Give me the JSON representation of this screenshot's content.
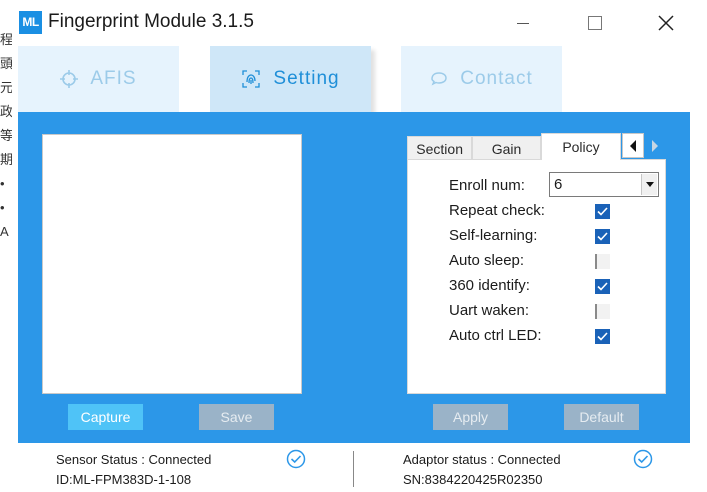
{
  "window": {
    "title": "Fingerprint Module 3.1.5",
    "logo_text": "ML",
    "accent_color": "#2c97e8"
  },
  "tabs": [
    {
      "label": "AFIS",
      "icon": "crosshair-icon",
      "active": false
    },
    {
      "label": "Setting",
      "icon": "fingerprint-icon",
      "active": true
    },
    {
      "label": "Contact",
      "icon": "chat-bubble-icon",
      "active": false
    }
  ],
  "background_text": [
    "程",
    "頭",
    "元",
    "政",
    "等",
    "期",
    "•",
    "•",
    "A"
  ],
  "buttons": {
    "capture": "Capture",
    "save": "Save",
    "apply": "Apply",
    "default": "Default"
  },
  "property_sheet": {
    "tabs": [
      "Section",
      "Gain",
      "Policy"
    ],
    "active_tab": "Policy",
    "enroll_num": {
      "label": "Enroll num:",
      "value": "6"
    },
    "options": [
      {
        "label": "Repeat check:",
        "checked": true
      },
      {
        "label": "Self-learning:",
        "checked": true
      },
      {
        "label": "Auto sleep:",
        "checked": false
      },
      {
        "label": "360 identify:",
        "checked": true
      },
      {
        "label": "Uart waken:",
        "checked": false
      },
      {
        "label": "Auto ctrl LED:",
        "checked": true
      }
    ]
  },
  "status": {
    "sensor": {
      "status": "Sensor Status : Connected",
      "id": "ID:ML-FPM383D-1-108"
    },
    "adaptor": {
      "status": "Adaptor status : Connected",
      "sn": "SN:8384220425R02350"
    }
  }
}
